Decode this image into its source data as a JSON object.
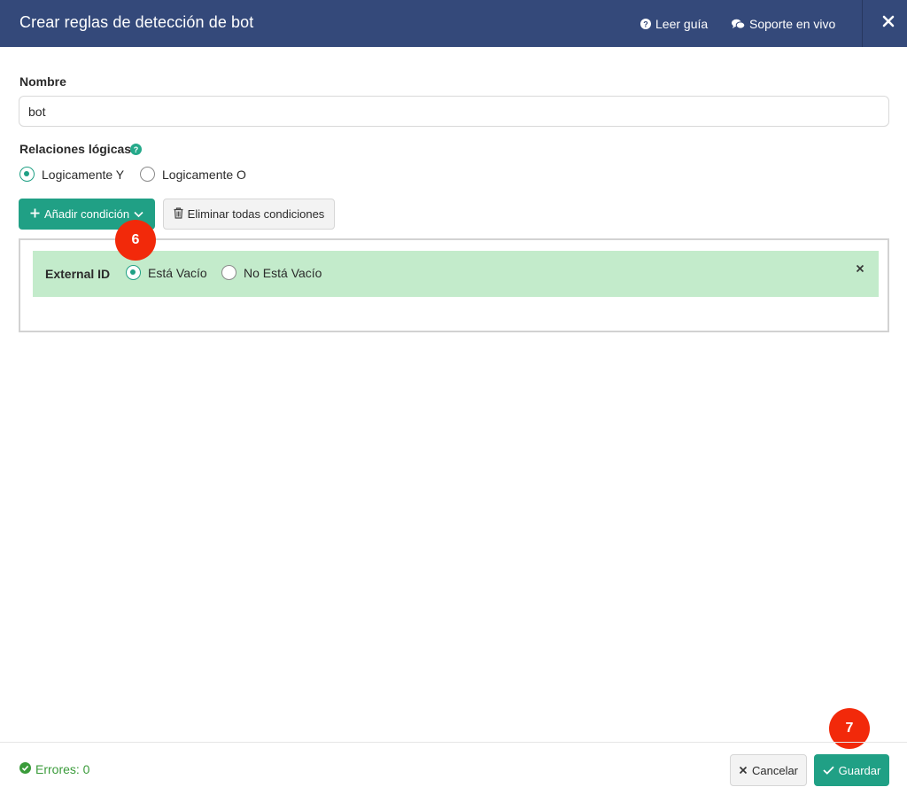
{
  "header": {
    "title": "Crear reglas de detección de bot",
    "guide_label": "Leer guía",
    "support_label": "Soporte en vivo",
    "bg_color": "#34497a"
  },
  "form": {
    "name_label": "Nombre",
    "name_value": "bot",
    "logic_label": "Relaciones lógicas",
    "logic_options": [
      {
        "label": "Logicamente Y",
        "checked": true
      },
      {
        "label": "Logicamente O",
        "checked": false
      }
    ],
    "add_condition_label": "Añadir condición",
    "clear_conditions_label": "Eliminar todas condiciones"
  },
  "conditions": [
    {
      "field": "External ID",
      "options": [
        {
          "label": "Está Vacío",
          "checked": true
        },
        {
          "label": "No Está Vacío",
          "checked": false
        }
      ]
    }
  ],
  "badges": {
    "step_a": "6",
    "step_b": "7"
  },
  "footer": {
    "errors_label": "Errores: 0",
    "cancel_label": "Cancelar",
    "save_label": "Guardar"
  },
  "colors": {
    "accent": "#20a085",
    "condition_bg": "#c3ebcb",
    "badge": "#f2290a",
    "success_text": "#3a9b3a"
  }
}
